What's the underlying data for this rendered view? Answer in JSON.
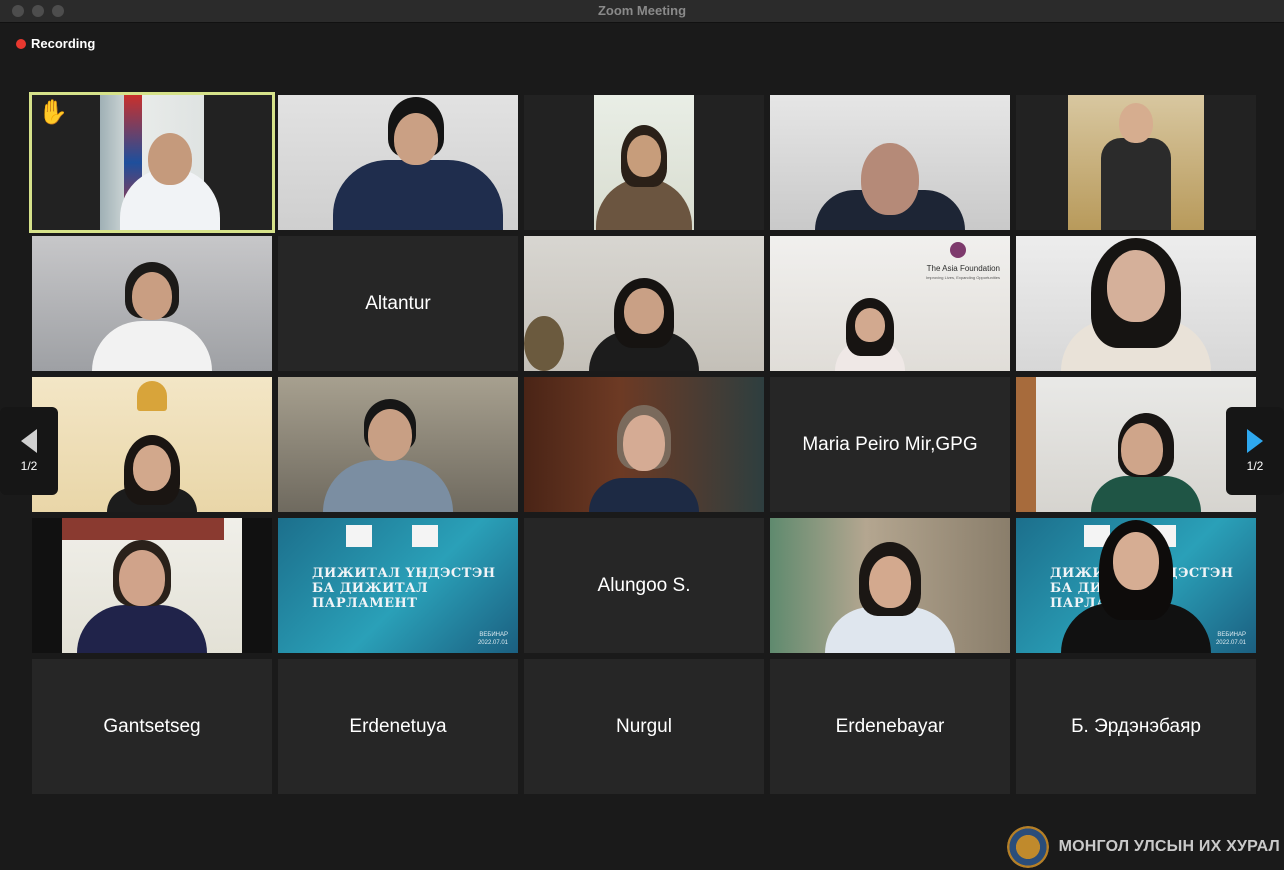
{
  "window": {
    "title": "Zoom Meeting"
  },
  "recording": {
    "label": "Recording",
    "color": "#e8382f"
  },
  "participants": [
    {
      "name": "",
      "type": "video",
      "active": true,
      "raised_hand": true
    },
    {
      "name": "",
      "type": "video"
    },
    {
      "name": "",
      "type": "video"
    },
    {
      "name": "",
      "type": "video"
    },
    {
      "name": "",
      "type": "video"
    },
    {
      "name": "",
      "type": "video"
    },
    {
      "name": "Altantur",
      "type": "name-only"
    },
    {
      "name": "",
      "type": "video"
    },
    {
      "name": "",
      "type": "video",
      "overlay": {
        "org": "The Asia Foundation",
        "tagline": "Improving Lives, Expanding Opportunities"
      }
    },
    {
      "name": "",
      "type": "video"
    },
    {
      "name": "",
      "type": "video"
    },
    {
      "name": "",
      "type": "video"
    },
    {
      "name": "",
      "type": "video"
    },
    {
      "name": "Maria Peiro Mir,GPG",
      "type": "name-only"
    },
    {
      "name": "",
      "type": "video"
    },
    {
      "name": "",
      "type": "video"
    },
    {
      "name": "",
      "type": "video",
      "slide": {
        "title_lines": [
          "ДИЖИТАЛ ҮНДЭСТЭН",
          "БА ДИЖИТАЛ",
          "ПАРЛАМЕНТ"
        ],
        "label": "ВЕБИНАР",
        "date": "2022.07.01"
      }
    },
    {
      "name": "Alungoo S.",
      "type": "name-only"
    },
    {
      "name": "",
      "type": "video"
    },
    {
      "name": "",
      "type": "video",
      "slide": {
        "title_lines": [
          "ДИЖИТАЛ ҮНДЭСТЭН",
          "БА ДИЖИТАЛ",
          "ПАРЛАМЕНТ"
        ],
        "label": "ВЕБИНАР",
        "date": "2022.07.01"
      }
    },
    {
      "name": "Gantsetseg",
      "type": "name-only"
    },
    {
      "name": "Erdenetuya",
      "type": "name-only"
    },
    {
      "name": "Nurgul",
      "type": "name-only"
    },
    {
      "name": "Erdenebayar",
      "type": "name-only"
    },
    {
      "name": "Б. Эрдэнэбаяр",
      "type": "name-only"
    }
  ],
  "pagination": {
    "prev_label": "1/2",
    "next_label": "1/2"
  },
  "watermark": {
    "text": "МОНГОЛ УЛСЫН ИХ ХУРАЛ"
  },
  "icons": {
    "raised_hand": "raised-hand-icon",
    "prev": "chevron-left-icon",
    "next": "chevron-right-icon",
    "seal": "seal-icon"
  },
  "colors": {
    "active_border": "#d6e28a",
    "next_arrow": "#2ea8ef",
    "background": "#1a1a1a",
    "tile": "#262626"
  }
}
